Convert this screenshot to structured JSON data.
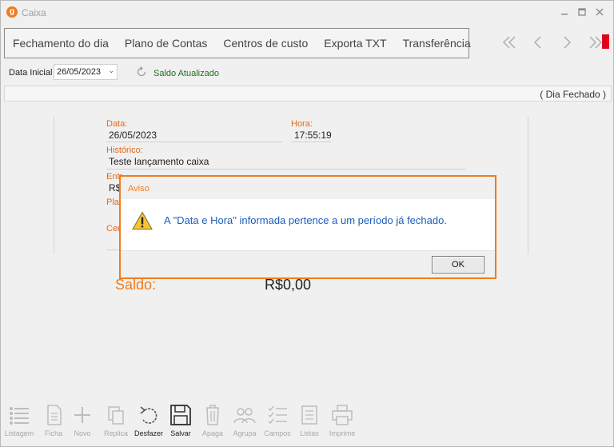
{
  "window": {
    "app_icon": "g",
    "title": "Caixa",
    "minimize_icon": "minimize-icon",
    "maximize_icon": "maximize-icon",
    "close_icon": "close-icon"
  },
  "tabs": [
    {
      "label": "Fechamento do dia"
    },
    {
      "label": "Plano de Contas"
    },
    {
      "label": "Centros de custo"
    },
    {
      "label": "Exporta TXT"
    },
    {
      "label": "Transferência"
    }
  ],
  "nav": [
    "double-chevron-left-icon",
    "chevron-left-icon",
    "chevron-right-icon",
    "double-chevron-right-icon"
  ],
  "filter": {
    "label": "Data Inicial",
    "date": "26/05/2023",
    "status": "Saldo Atualizado"
  },
  "status_strip": {
    "text": "( Dia Fechado )"
  },
  "form": {
    "data_label": "Data:",
    "data_value": "26/05/2023",
    "hora_label": "Hora:",
    "hora_value": "17:55:19",
    "historico_label": "Histórico:",
    "historico_value": "Teste lançamento caixa",
    "entrada_label": "Entr",
    "entrada_value": "R$",
    "plano_label": "Plan",
    "centro_label": "Cen",
    "saldo_label": "Saldo:",
    "saldo_value": "R$0,00"
  },
  "dialog": {
    "title": "Aviso",
    "icon": "warning-icon",
    "message": "A \"Data e Hora\" informada pertence a um período já fechado.",
    "ok_label": "OK"
  },
  "toolbar": [
    {
      "label": "Listagem",
      "icon": "list-icon",
      "active": false
    },
    {
      "label": "Ficha",
      "icon": "document-icon",
      "active": false
    },
    {
      "label": "Novo",
      "icon": "plus-icon",
      "active": false
    },
    {
      "label": "Replica",
      "icon": "copy-icon",
      "active": false
    },
    {
      "label": "Desfazer",
      "icon": "undo-icon",
      "active": true
    },
    {
      "label": "Salvar",
      "icon": "save-icon",
      "active": true
    },
    {
      "label": "Apaga",
      "icon": "trash-icon",
      "active": false
    },
    {
      "label": "Agrupa",
      "icon": "group-icon",
      "active": false
    },
    {
      "label": "Campos",
      "icon": "checklist-icon",
      "active": false
    },
    {
      "label": "Listas",
      "icon": "lists-icon",
      "active": false
    },
    {
      "label": "Imprime",
      "icon": "printer-icon",
      "active": false
    }
  ],
  "colors": {
    "accent": "#f07c1b",
    "message": "#1e5ebc",
    "status_green": "#1e6e1e",
    "red_marker": "#e0001b"
  }
}
